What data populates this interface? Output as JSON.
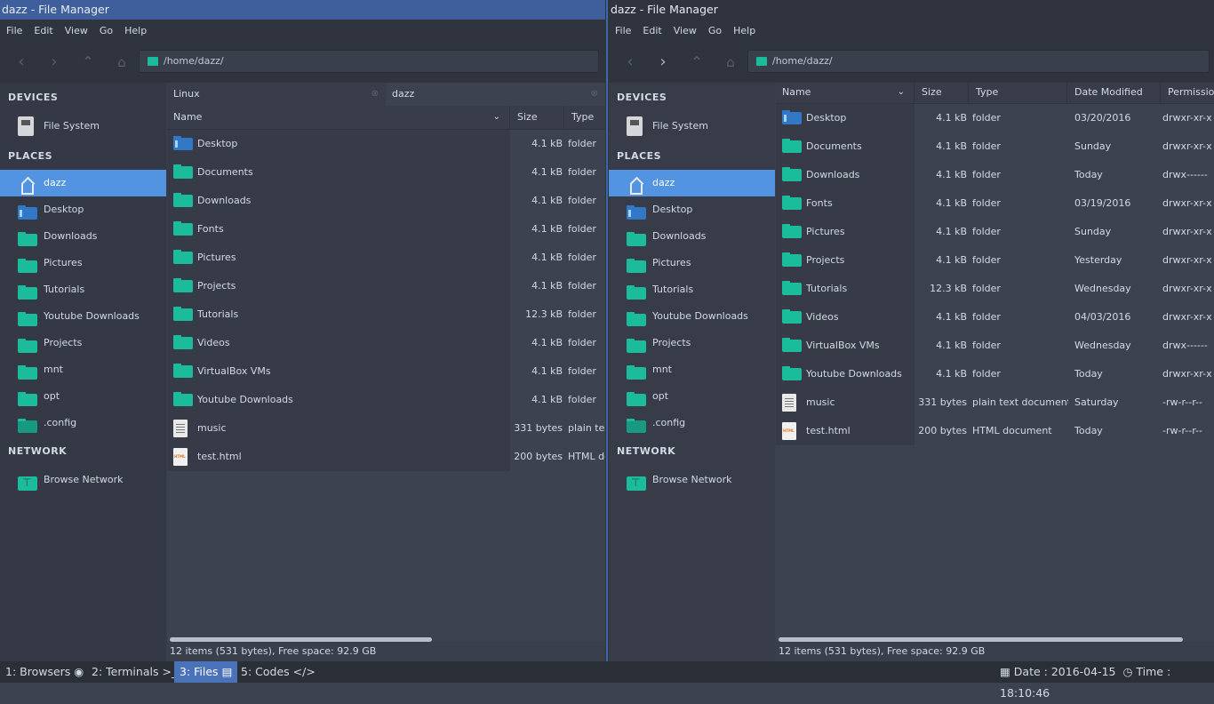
{
  "left": {
    "title": "dazz - File Manager",
    "menu": [
      "File",
      "Edit",
      "View",
      "Go",
      "Help"
    ],
    "path": "/home/dazz/",
    "tabs": [
      "Linux",
      "dazz"
    ],
    "columns": [
      "Name",
      "Size",
      "Type"
    ],
    "files": [
      {
        "name": "Desktop",
        "size": "4.1 kB",
        "type": "folder",
        "icon": "desktop-folder-icon"
      },
      {
        "name": "Documents",
        "size": "4.1 kB",
        "type": "folder",
        "icon": "folder-icon"
      },
      {
        "name": "Downloads",
        "size": "4.1 kB",
        "type": "folder",
        "icon": "folder-icon"
      },
      {
        "name": "Fonts",
        "size": "4.1 kB",
        "type": "folder",
        "icon": "folder-icon"
      },
      {
        "name": "Pictures",
        "size": "4.1 kB",
        "type": "folder",
        "icon": "folder-icon"
      },
      {
        "name": "Projects",
        "size": "4.1 kB",
        "type": "folder",
        "icon": "folder-icon"
      },
      {
        "name": "Tutorials",
        "size": "12.3 kB",
        "type": "folder",
        "icon": "folder-icon"
      },
      {
        "name": "Videos",
        "size": "4.1 kB",
        "type": "folder",
        "icon": "folder-icon"
      },
      {
        "name": "VirtualBox VMs",
        "size": "4.1 kB",
        "type": "folder",
        "icon": "folder-icon"
      },
      {
        "name": "Youtube Downloads",
        "size": "4.1 kB",
        "type": "folder",
        "icon": "folder-icon"
      },
      {
        "name": "music",
        "size": "331 bytes",
        "type": "plain text",
        "icon": "text-file-icon"
      },
      {
        "name": "test.html",
        "size": "200 bytes",
        "type": "HTML dc",
        "icon": "html-file-icon"
      }
    ],
    "status": "12 items (531 bytes), Free space: 92.9 GB"
  },
  "right": {
    "title": "dazz - File Manager",
    "menu": [
      "File",
      "Edit",
      "View",
      "Go",
      "Help"
    ],
    "path": "/home/dazz/",
    "columns": [
      "Name",
      "Size",
      "Type",
      "Date Modified",
      "Permission"
    ],
    "files": [
      {
        "name": "Desktop",
        "size": "4.1 kB",
        "type": "folder",
        "date": "03/20/2016",
        "perm": "drwxr-xr-x",
        "icon": "desktop-folder-icon"
      },
      {
        "name": "Documents",
        "size": "4.1 kB",
        "type": "folder",
        "date": "Sunday",
        "perm": "drwxr-xr-x",
        "icon": "folder-icon"
      },
      {
        "name": "Downloads",
        "size": "4.1 kB",
        "type": "folder",
        "date": "Today",
        "perm": "drwx------",
        "icon": "folder-icon"
      },
      {
        "name": "Fonts",
        "size": "4.1 kB",
        "type": "folder",
        "date": "03/19/2016",
        "perm": "drwxr-xr-x",
        "icon": "folder-icon"
      },
      {
        "name": "Pictures",
        "size": "4.1 kB",
        "type": "folder",
        "date": "Sunday",
        "perm": "drwxr-xr-x",
        "icon": "folder-icon"
      },
      {
        "name": "Projects",
        "size": "4.1 kB",
        "type": "folder",
        "date": "Yesterday",
        "perm": "drwxr-xr-x",
        "icon": "folder-icon"
      },
      {
        "name": "Tutorials",
        "size": "12.3 kB",
        "type": "folder",
        "date": "Wednesday",
        "perm": "drwxr-xr-x",
        "icon": "folder-icon"
      },
      {
        "name": "Videos",
        "size": "4.1 kB",
        "type": "folder",
        "date": "04/03/2016",
        "perm": "drwxr-xr-x",
        "icon": "folder-icon"
      },
      {
        "name": "VirtualBox VMs",
        "size": "4.1 kB",
        "type": "folder",
        "date": "Wednesday",
        "perm": "drwx------",
        "icon": "folder-icon"
      },
      {
        "name": "Youtube Downloads",
        "size": "4.1 kB",
        "type": "folder",
        "date": "Today",
        "perm": "drwxr-xr-x",
        "icon": "folder-icon"
      },
      {
        "name": "music",
        "size": "331 bytes",
        "type": "plain text document",
        "date": "Saturday",
        "perm": "-rw-r--r--",
        "icon": "text-file-icon"
      },
      {
        "name": "test.html",
        "size": "200 bytes",
        "type": "HTML document",
        "date": "Today",
        "perm": "-rw-r--r--",
        "icon": "html-file-icon"
      }
    ],
    "status": "12 items (531 bytes), Free space: 92.9 GB"
  },
  "sidebar": {
    "devices_heading": "DEVICES",
    "file_system": "File System",
    "places_heading": "PLACES",
    "places": [
      {
        "label": "dazz",
        "icon": "home-icon",
        "selected": true
      },
      {
        "label": "Desktop",
        "icon": "desktop-folder-icon"
      },
      {
        "label": "Downloads",
        "icon": "folder-icon"
      },
      {
        "label": "Pictures",
        "icon": "folder-icon"
      },
      {
        "label": "Tutorials",
        "icon": "folder-icon"
      },
      {
        "label": "Youtube Downloads",
        "icon": "folder-icon"
      },
      {
        "label": "Projects",
        "icon": "folder-icon"
      },
      {
        "label": "mnt",
        "icon": "folder-icon"
      },
      {
        "label": "opt",
        "icon": "folder-icon"
      },
      {
        "label": ".config",
        "icon": "folder-icon"
      }
    ],
    "network_heading": "NETWORK",
    "browse_network": "Browse Network"
  },
  "taskbar": {
    "workspaces": [
      {
        "label": "1: Browsers",
        "glyph": "◉"
      },
      {
        "label": "2: Terminals",
        "glyph": ">_"
      },
      {
        "label": "3: Files",
        "glyph": "▤",
        "active": true
      },
      {
        "label": "5: Codes",
        "glyph": "</>"
      }
    ],
    "date_label": "Date :",
    "date": "2016-04-15",
    "time_label": "Time :",
    "time": "18:10:46"
  },
  "colors": {
    "accent": "#5294e2",
    "folder": "#1abc9c",
    "active_title": "#3e5f9c",
    "active_workspace": "#4a72b8"
  }
}
